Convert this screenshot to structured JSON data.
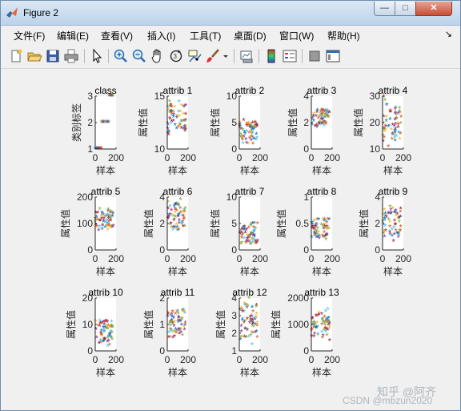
{
  "window": {
    "title": "Figure 2",
    "min_glyph": "—",
    "max_glyph": "□",
    "close_glyph": "✕"
  },
  "menu": {
    "items": [
      {
        "label": "文件(F)"
      },
      {
        "label": "编辑(E)"
      },
      {
        "label": "查看(V)"
      },
      {
        "label": "插入(I)"
      },
      {
        "label": "工具(T)"
      },
      {
        "label": "桌面(D)"
      },
      {
        "label": "窗口(W)"
      },
      {
        "label": "帮助(H)"
      }
    ],
    "overflow_glyph": "↘"
  },
  "toolbar": {
    "icons": [
      "new-figure-icon",
      "open-file-icon",
      "save-icon",
      "print-icon",
      "pointer-icon",
      "zoom-in-icon",
      "zoom-out-icon",
      "pan-hand-icon",
      "rotate-3d-icon",
      "data-cursor-icon",
      "brush-icon",
      "brush-dropdown-icon",
      "link-plot-icon",
      "colorbar-icon",
      "legend-icon",
      "hide-plot-tools-icon",
      "show-plot-tools-icon"
    ]
  },
  "chart_data": {
    "type": "scatter",
    "grid_layout": "3x5 subplots",
    "xlabel": "样本",
    "marker": "*",
    "series_colors": [
      "#0072BD",
      "#D95319",
      "#EDB120",
      "#7E2F8E",
      "#77AC30",
      "#4DBEEE",
      "#A2142F"
    ],
    "subplots": [
      {
        "title": "class",
        "ylabel": "类别标签",
        "ylim": [
          1,
          3
        ],
        "yticks": [
          "1",
          "2",
          "3"
        ],
        "xticks": [
          "0",
          "200"
        ],
        "approx_range": [
          1,
          3
        ]
      },
      {
        "title": "attrib 1",
        "ylabel": "属性值",
        "ylim": [
          10,
          15
        ],
        "yticks": [
          "10",
          "15"
        ],
        "xticks": [
          "0",
          "200"
        ],
        "approx_range": [
          11,
          14.8
        ]
      },
      {
        "title": "attrib 2",
        "ylabel": "属性值",
        "ylim": [
          0,
          10
        ],
        "yticks": [
          "0",
          "5",
          "10"
        ],
        "xticks": [
          "0",
          "200"
        ],
        "approx_range": [
          0.7,
          5.8
        ]
      },
      {
        "title": "attrib 3",
        "ylabel": "属性值",
        "ylim": [
          0,
          4
        ],
        "yticks": [
          "0",
          "2",
          "4"
        ],
        "xticks": [
          "0",
          "200"
        ],
        "approx_range": [
          1.4,
          3.2
        ]
      },
      {
        "title": "attrib 4",
        "ylabel": "属性值",
        "ylim": [
          10,
          30
        ],
        "yticks": [
          "10",
          "20",
          "30"
        ],
        "xticks": [
          "0",
          "200"
        ],
        "approx_range": [
          10.6,
          30
        ]
      },
      {
        "title": "attrib 5",
        "ylabel": "属性值",
        "ylim": [
          0,
          200
        ],
        "yticks": [
          "0",
          "100",
          "200"
        ],
        "xticks": [
          "0",
          "200"
        ],
        "approx_range": [
          70,
          162
        ]
      },
      {
        "title": "attrib 6",
        "ylabel": "属性值",
        "ylim": [
          0,
          4
        ],
        "yticks": [
          "0",
          "2",
          "4"
        ],
        "xticks": [
          "0",
          "200"
        ],
        "approx_range": [
          1,
          3.9
        ]
      },
      {
        "title": "attrib 7",
        "ylabel": "属性值",
        "ylim": [
          0,
          10
        ],
        "yticks": [
          "0",
          "5",
          "10"
        ],
        "xticks": [
          "0",
          "200"
        ],
        "approx_range": [
          0.3,
          5.1
        ]
      },
      {
        "title": "attrib 8",
        "ylabel": "属性值",
        "ylim": [
          0,
          1
        ],
        "yticks": [
          "0",
          "0.5",
          "1"
        ],
        "xticks": [
          "0",
          "200"
        ],
        "approx_range": [
          0.13,
          0.66
        ]
      },
      {
        "title": "attrib 9",
        "ylabel": "属性值",
        "ylim": [
          0,
          4
        ],
        "yticks": [
          "0",
          "2",
          "4"
        ],
        "xticks": [
          "0",
          "200"
        ],
        "approx_range": [
          0.4,
          3.6
        ]
      },
      {
        "title": "attrib 10",
        "ylabel": "属性值",
        "ylim": [
          0,
          20
        ],
        "yticks": [
          "0",
          "10",
          "20"
        ],
        "xticks": [
          "0",
          "200"
        ],
        "approx_range": [
          1.3,
          13
        ]
      },
      {
        "title": "attrib 11",
        "ylabel": "属性值",
        "ylim": [
          0,
          2
        ],
        "yticks": [
          "0",
          "1",
          "2"
        ],
        "xticks": [
          "0",
          "200"
        ],
        "approx_range": [
          0.48,
          1.71
        ]
      },
      {
        "title": "attrib 12",
        "ylabel": "属性值",
        "ylim": [
          1,
          4
        ],
        "yticks": [
          "1",
          "2",
          "3",
          "4"
        ],
        "xticks": [
          "0",
          "200"
        ],
        "approx_range": [
          1.27,
          4
        ]
      },
      {
        "title": "attrib 13",
        "ylabel": "属性值",
        "ylim": [
          0,
          2000
        ],
        "yticks": [
          "0",
          "1000",
          "2000"
        ],
        "xticks": [
          "0",
          "200"
        ],
        "approx_range": [
          278,
          1680
        ]
      }
    ]
  },
  "watermark": {
    "line1": "知乎 @阿齐",
    "line2": "CSDN @mbzun2020"
  }
}
